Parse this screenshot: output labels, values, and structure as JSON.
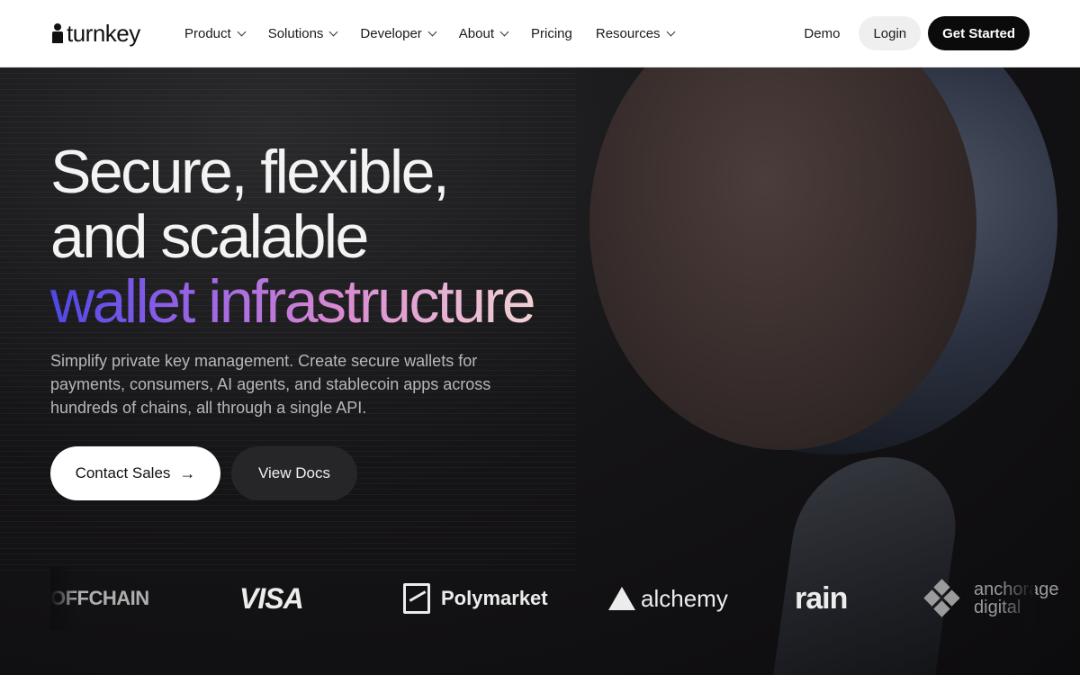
{
  "nav": {
    "logo_text": "turnkey",
    "items": [
      {
        "label": "Product",
        "dropdown": true
      },
      {
        "label": "Solutions",
        "dropdown": true
      },
      {
        "label": "Developer",
        "dropdown": true
      },
      {
        "label": "About",
        "dropdown": true
      },
      {
        "label": "Pricing",
        "dropdown": false
      },
      {
        "label": "Resources",
        "dropdown": true
      }
    ],
    "demo": "Demo",
    "login": "Login",
    "get_started": "Get Started"
  },
  "hero": {
    "line1": "Secure, flexible,",
    "line2": "and scalable",
    "line3": "wallet infrastructure",
    "subtitle": "Simplify private key management. Create secure wallets for payments, consumers, AI agents, and stablecoin apps across hundreds of chains, all through a single API.",
    "contact_sales": "Contact Sales",
    "contact_arrow": "→",
    "view_docs": "View Docs"
  },
  "logos": {
    "offchain": "OFFCHAIN",
    "visa": "VISA",
    "polymarket": "Polymarket",
    "alchemy": "alchemy",
    "rain": "rain",
    "anchorage_1": "anchorage",
    "anchorage_2": "digital"
  },
  "colors": {
    "nav_bg": "#ffffff",
    "hero_bg": "#0e0d0f",
    "accent_gradient_start": "#4d48e6",
    "accent_gradient_end": "#f1d2d4",
    "primary_button": "#0b0b0b"
  }
}
